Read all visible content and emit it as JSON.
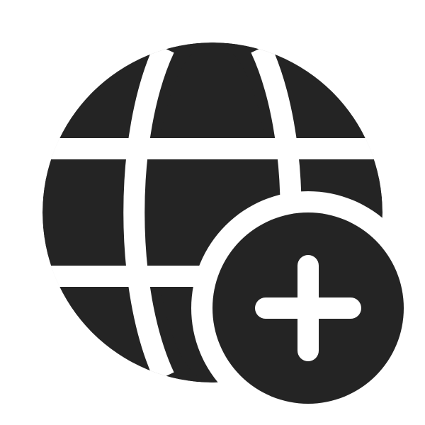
{
  "icon": {
    "name": "globe-add-icon",
    "color": "#242424",
    "background": "#ffffff"
  }
}
